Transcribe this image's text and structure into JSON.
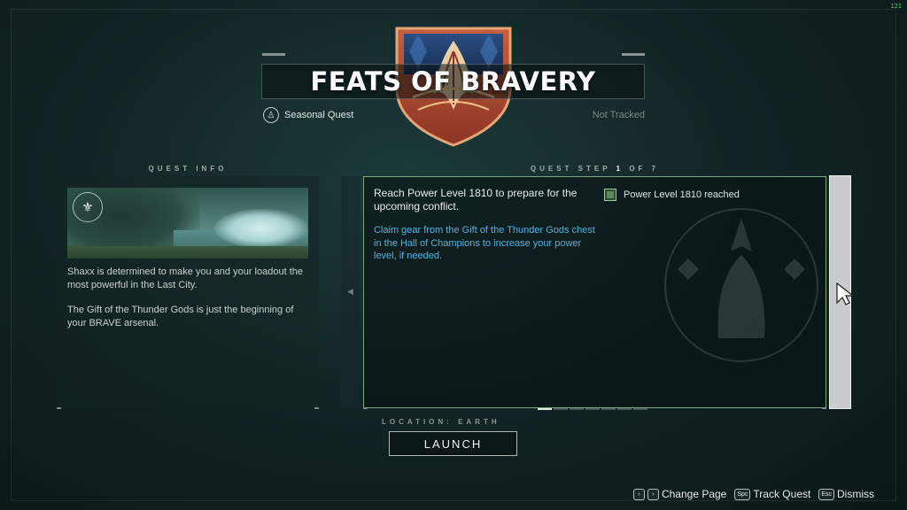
{
  "hud": {
    "fps": "121"
  },
  "header": {
    "title": "FEATS OF BRAVERY",
    "quest_type": "Seasonal Quest",
    "tracking_status": "Not Tracked"
  },
  "quest_info": {
    "heading": "QUEST INFO",
    "paragraph_1": "Shaxx is determined to make you and your loadout the most powerful in the Last City.",
    "paragraph_2": "The Gift of the Thunder Gods is just the beginning of your BRAVE arsenal."
  },
  "quest_step": {
    "heading_prefix": "QUEST STEP",
    "current": "1",
    "heading_of": "OF",
    "total": "7",
    "objective": "Reach Power Level 1810 to prepare for the upcoming conflict.",
    "hint": "Claim gear from the Gift of the Thunder Gods chest in the Hall of Champions to increase your power level, if needed.",
    "checklist": [
      {
        "label": "Power Level 1810 reached",
        "checked": false
      }
    ],
    "pages": 7,
    "current_page": 1
  },
  "location": {
    "label": "LOCATION: EARTH"
  },
  "launch": {
    "label": "LAUNCH"
  },
  "footer": {
    "prompts": [
      {
        "keys": [
          "‹",
          "›"
        ],
        "label": "Change Page"
      },
      {
        "keys": [
          "Spc"
        ],
        "label": "Track Quest"
      },
      {
        "keys": [
          "Esc"
        ],
        "label": "Dismiss"
      }
    ]
  },
  "colors": {
    "accent_green": "#7aa67c",
    "hint_blue": "#4fb3e0",
    "emblem_red": "#b04c34",
    "emblem_navy": "#1d3a66"
  }
}
